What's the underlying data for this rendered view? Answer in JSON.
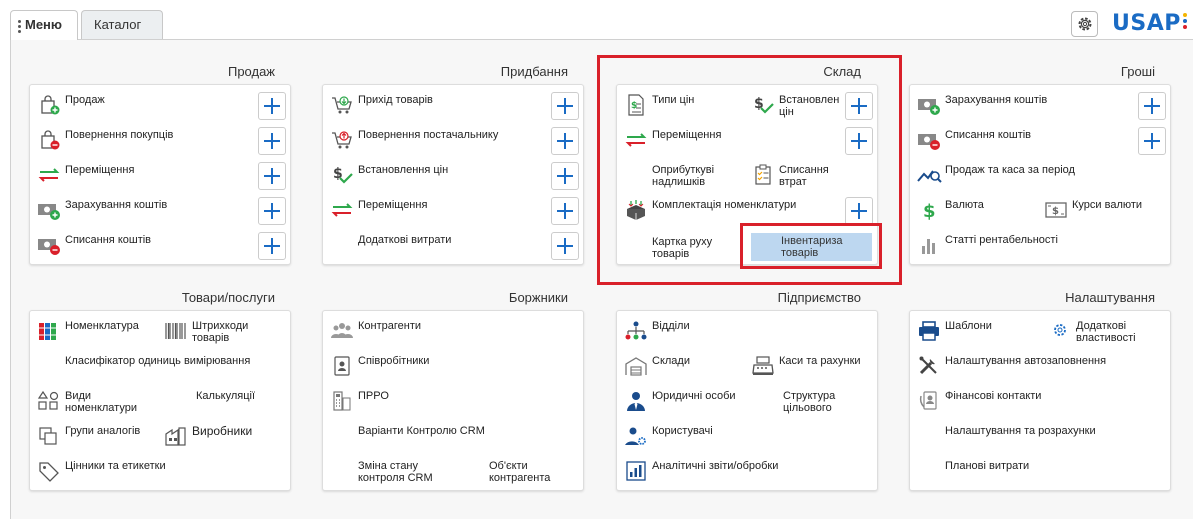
{
  "tabs": {
    "menu": "Меню",
    "catalog": "Каталог"
  },
  "logo": {
    "text": "USAP",
    "dot_colors": [
      "#f4b400",
      "#1a6bc4",
      "#d9202a"
    ]
  },
  "colors": {
    "accent": "#1a6bc4",
    "highlight": "#d9202a",
    "selected": "#bdd7f0"
  },
  "sections": {
    "sales": {
      "title": "Продаж",
      "items": [
        "Продаж",
        "Повернення покупців",
        "Переміщення",
        "Зарахування коштів",
        "Списання коштів"
      ]
    },
    "purchase": {
      "title": "Придбання",
      "items": [
        "Прихід товарів",
        "Повернення постачальнику",
        "Встановлення цін",
        "Переміщення",
        "Додаткові витрати"
      ]
    },
    "warehouse": {
      "title": "Склад",
      "items": [
        "Типи цін",
        "Встановлення цін",
        "Переміщення",
        "Оприбуткуванн надлишків",
        "Списання втрат",
        "Комплектація номенклатури",
        "Картка руху товарів",
        "Інвентаризація товарів"
      ],
      "display": {
        "set_prices": "Встановлен цін",
        "surplus": "Оприбуткуві надлишків",
        "inventory": "Інвентариза товарів"
      }
    },
    "money": {
      "title": "Гроші",
      "items": [
        "Зарахування коштів",
        "Списання коштів",
        "Продаж та каса за період",
        "Валюта",
        "Курси валюти",
        "Статті рентабельності"
      ]
    },
    "goods": {
      "title": "Товари/послуги",
      "items": [
        "Номенклатура",
        "Штрихкоди товарів",
        "Класифікатор одиниць вимірювання",
        "Види номенклатури",
        "Калькуляції",
        "Групи аналогів",
        "Виробники",
        "Цінники та етикетки"
      ]
    },
    "debtors": {
      "title": "Боржники",
      "items": [
        "Контрагенти",
        "Співробітники",
        "ПРРО",
        "Варіанти Контролю CRM",
        "Зміна стану контроля CRM",
        "Об'єкти контрагента"
      ]
    },
    "enterprise": {
      "title": "Підприємство",
      "items": [
        "Відділи",
        "Склади",
        "Каси та рахунки",
        "Юридичні особи",
        "Структура цільового",
        "Користувачі",
        "Аналітичні звіти/обробки"
      ]
    },
    "settings": {
      "title": "Налаштування",
      "items": [
        "Шаблони",
        "Додаткові властивості",
        "Налаштування автозаповнення",
        "Фінансові контакти",
        "Налаштування та розрахунки",
        "Планові витрати"
      ]
    }
  }
}
